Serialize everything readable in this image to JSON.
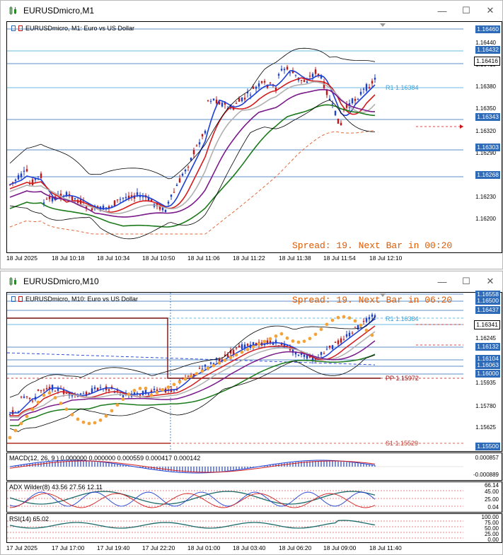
{
  "window1": {
    "title": "EURUSDmicro,M1",
    "chart_label": "EURUSDmicro, M1:  Euro vs US Dollar",
    "price_tags": [
      {
        "value": "1.16460",
        "kind": "line"
      },
      {
        "value": "1.16432",
        "kind": "line"
      },
      {
        "value": "1.16416",
        "kind": "current"
      },
      {
        "value": "1.16343",
        "kind": "line"
      },
      {
        "value": "1.16303",
        "kind": "line"
      },
      {
        "value": "1.16268",
        "kind": "line"
      }
    ],
    "price_scale": [
      "1.16440",
      "1.16410",
      "1.16380",
      "1.16350",
      "1.16320",
      "1.16290",
      "1.16260",
      "1.16230",
      "1.16200"
    ],
    "pivot": {
      "label": "R1 1.16384"
    },
    "spread": "Spread: 19. Next Bar in 00:20",
    "x_labels": [
      "18 Jul 2025",
      "18 Jul 10:18",
      "18 Jul 10:34",
      "18 Jul 10:50",
      "18 Jul 11:06",
      "18 Jul 11:22",
      "18 Jul 11:38",
      "18 Jul 11:54",
      "18 Jul 12:10"
    ]
  },
  "window2": {
    "title": "EURUSDmicro,M10",
    "chart_label": "EURUSDmicro, M10:  Euro vs US Dollar",
    "spread": "Spread: 19. Next Bar in 06:20",
    "price_tags": [
      {
        "value": "1.16558",
        "kind": "line"
      },
      {
        "value": "1.16500",
        "kind": "line"
      },
      {
        "value": "1.16437",
        "kind": "line"
      },
      {
        "value": "1.16341",
        "kind": "current"
      },
      {
        "value": "1.16132",
        "kind": "line"
      },
      {
        "value": "1.16104",
        "kind": "line"
      },
      {
        "value": "1.16063",
        "kind": "line"
      },
      {
        "value": "1.16000",
        "kind": "line"
      },
      {
        "value": "1.15500",
        "kind": "line"
      }
    ],
    "price_scale": [
      "1.16245",
      "1.15935",
      "1.15780",
      "1.15625"
    ],
    "pivots": {
      "r1": "R1 1.16384",
      "pp": "PP 1.15972",
      "s1": "S1 1.15529"
    },
    "macd": {
      "label": "MACD(12, 26, 9 ) 0.000000 0.000000 0.000559 0.000417 0.000142",
      "scale": [
        "0.000857",
        "-0.000889"
      ]
    },
    "adx": {
      "label": "ADX Wilder(8) 43.56 27.56 12.11",
      "scale": [
        "66.14",
        "45.00",
        "25.00",
        "0.04"
      ]
    },
    "rsi": {
      "label": "RSI(14) 65.02",
      "scale": [
        "100.00",
        "75.00",
        "50.00",
        "25.00",
        "0.00"
      ]
    },
    "x_labels": [
      "17 Jul 2025",
      "17 Jul 17:00",
      "17 Jul 19:40",
      "17 Jul 22:20",
      "18 Jul 01:00",
      "18 Jul 03:40",
      "18 Jul 06:20",
      "18 Jul 09:00",
      "18 Jul 11:40"
    ]
  },
  "controls": {
    "minimize": "—",
    "restore": "☐",
    "close": "✕"
  },
  "colors": {
    "tag_blue": "#2d6ab7",
    "spread_orange": "#e05a00",
    "bull": "#1c3fd4",
    "bear": "#c81414",
    "pivot_blue": "#3aa0d8",
    "pp_red": "#a01010"
  }
}
